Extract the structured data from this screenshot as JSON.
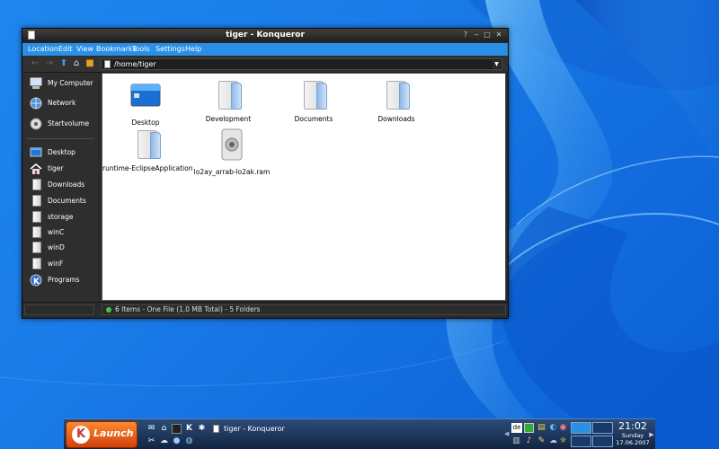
{
  "window": {
    "title": "tiger - Konqueror"
  },
  "menubar": {
    "items": [
      "Location",
      "Edit",
      "View",
      "Bookmarks",
      "Tools",
      "Settings",
      "Help"
    ]
  },
  "location_bar": {
    "value": "/home/tiger"
  },
  "sidebar": {
    "items": [
      {
        "label": "My Computer",
        "icon": "computer-icon"
      },
      {
        "label": "Network",
        "icon": "network-icon"
      },
      {
        "label": "Startvolume",
        "icon": "disk-icon"
      },
      {
        "label": "Desktop",
        "icon": "desktop-icon"
      },
      {
        "label": "tiger",
        "icon": "home-icon"
      },
      {
        "label": "Downloads",
        "icon": "folder-icon"
      },
      {
        "label": "Documents",
        "icon": "folder-icon"
      },
      {
        "label": "storage",
        "icon": "folder-icon"
      },
      {
        "label": "winC",
        "icon": "folder-icon"
      },
      {
        "label": "winD",
        "icon": "folder-icon"
      },
      {
        "label": "winF",
        "icon": "folder-icon"
      },
      {
        "label": "Programs",
        "icon": "kde-icon"
      }
    ]
  },
  "files": [
    {
      "name": "Desktop",
      "icon": "desktop-folder-icon"
    },
    {
      "name": "Development",
      "icon": "folder-icon"
    },
    {
      "name": "Documents",
      "icon": "folder-icon"
    },
    {
      "name": "Downloads",
      "icon": "folder-icon"
    },
    {
      "name": "runtime-EclipseApplication",
      "icon": "folder-icon"
    },
    {
      "name": "lo2ay_arrab-lo2ak.ram",
      "icon": "audio-file-icon"
    }
  ],
  "statusbar": {
    "text": "6 Items - One File (1,0 MB Total) - 5 Folders"
  },
  "taskbar": {
    "launch_label": "Launch",
    "task_title": "tiger - Konqueror",
    "keyboard_layout": "de"
  },
  "clock": {
    "time": "21:02",
    "day": "Sunday",
    "date": "17.06.2007"
  },
  "colors": {
    "accent": "#2a8fe6",
    "desktop": "#1a7ce8",
    "window_bg": "#2b2b2b"
  }
}
